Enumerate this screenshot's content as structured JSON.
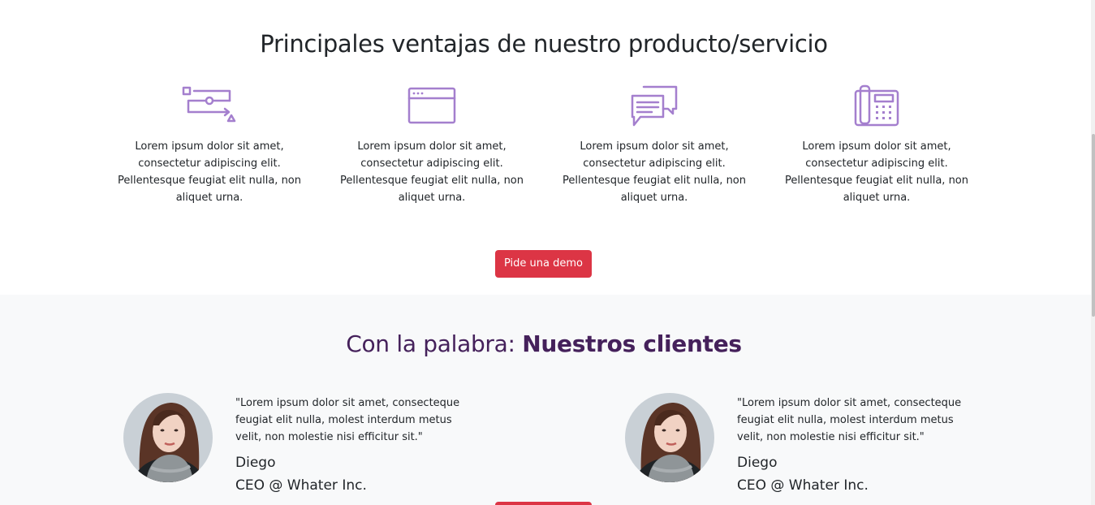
{
  "features": {
    "title": "Principales ventajas de nuestro producto/servicio",
    "items": [
      {
        "icon": "workflow-icon",
        "text": "Lorem ipsum dolor sit amet, consectetur adipiscing elit. Pellentesque feugiat elit nulla, non aliquet urna."
      },
      {
        "icon": "browser-window-icon",
        "text": "Lorem ipsum dolor sit amet, consectetur adipiscing elit. Pellentesque feugiat elit nulla, non aliquet urna."
      },
      {
        "icon": "chat-bubbles-icon",
        "text": "Lorem ipsum dolor sit amet, consectetur adipiscing elit. Pellentesque feugiat elit nulla, non aliquet urna."
      },
      {
        "icon": "desk-phone-icon",
        "text": "Lorem ipsum dolor sit amet, consectetur adipiscing elit. Pellentesque feugiat elit nulla, non aliquet urna."
      }
    ],
    "cta_label": "Pide una demo"
  },
  "testimonials": {
    "title_prefix": "Con la palabra: ",
    "title_bold": "Nuestros clientes",
    "items": [
      {
        "quote": "\"Lorem ipsum dolor sit amet, consecteque feugiat elit nulla, molest interdum metus velit, non molestie nisi efficitur sit.\"",
        "name": "Diego",
        "role": "CEO @ Whater Inc."
      },
      {
        "quote": "\"Lorem ipsum dolor sit amet, consecteque feugiat elit nulla, molest interdum metus velit, non molestie nisi efficitur sit.\"",
        "name": "Diego",
        "role": "CEO @ Whater Inc."
      }
    ]
  },
  "colors": {
    "accent": "#dc3545",
    "icon": "#a47fce",
    "heading_purple": "#45215b",
    "section_bg": "#f8f9fa"
  }
}
